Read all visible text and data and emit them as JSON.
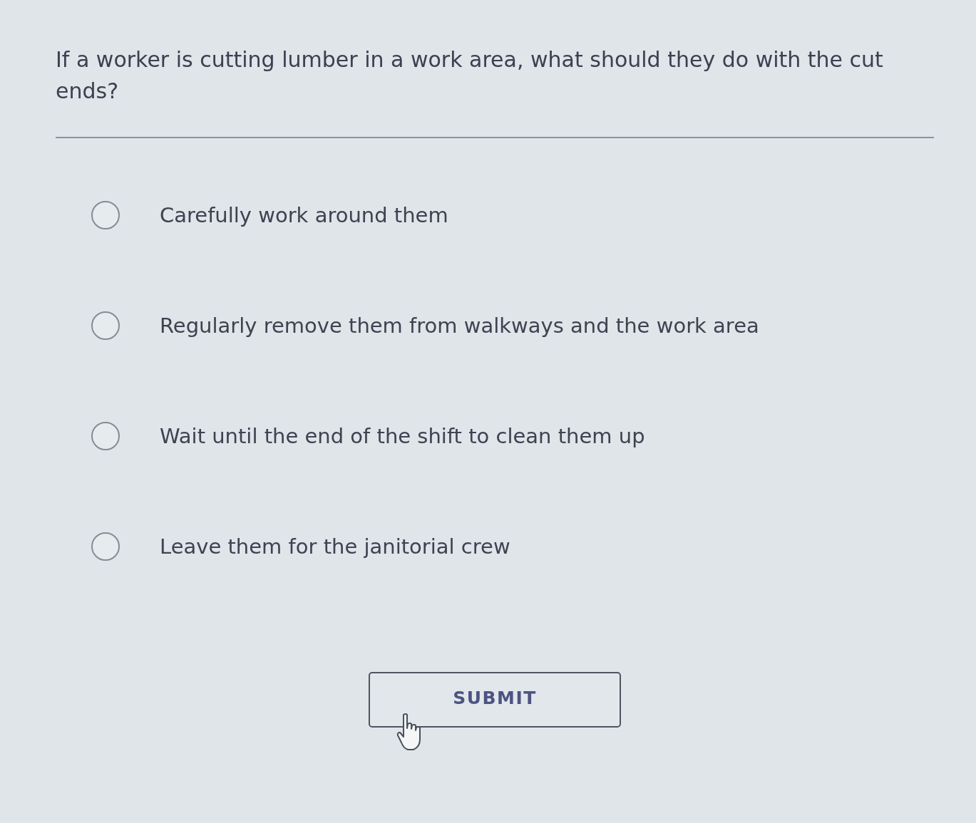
{
  "question": "If a worker is cutting lumber in a work area, what should they do with the cut ends?",
  "options": [
    {
      "label": "Carefully work around them",
      "selected": false
    },
    {
      "label": "Regularly remove them from walkways and the work area",
      "selected": false
    },
    {
      "label": "Wait until the end of the shift to clean them up",
      "selected": false
    },
    {
      "label": "Leave them for the janitorial crew",
      "selected": false
    }
  ],
  "submit_button": {
    "label": "SUBMIT"
  }
}
